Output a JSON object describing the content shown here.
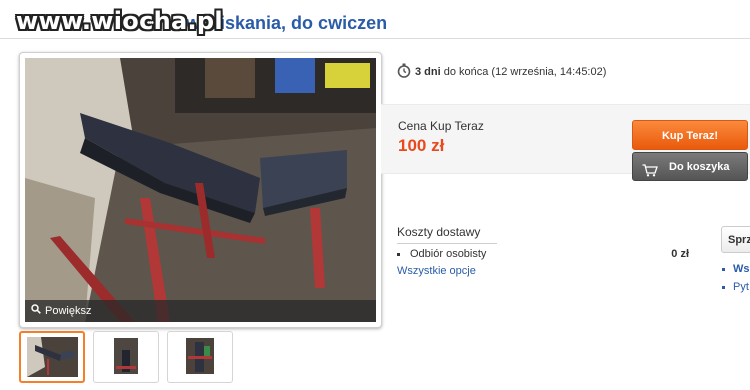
{
  "watermark": "www.wiocha.pl",
  "listing": {
    "title_visible": "d wyciskania, do cwiczen"
  },
  "gallery": {
    "enlarge_label": "Powiększ",
    "thumbnail_count": 3
  },
  "timer": {
    "days": "3 dni",
    "rest": "do końca (12 września, 14:45:02)"
  },
  "buy_now": {
    "label": "Cena Kup Teraz",
    "price": "100 zł",
    "buy_button": "Kup Teraz!",
    "cart_button": "Do koszyka"
  },
  "shipping": {
    "title": "Koszty dostawy",
    "option": "Odbiór osobisty",
    "cost": "0 zł",
    "all_options": "Wszystkie opcje"
  },
  "seller": {
    "button": "Sprz",
    "link1": "Ws",
    "link2": "Pyt"
  },
  "colors": {
    "accent_orange": "#ea5a0c",
    "link_blue": "#2b5ca8",
    "price_red": "#e8491d"
  }
}
